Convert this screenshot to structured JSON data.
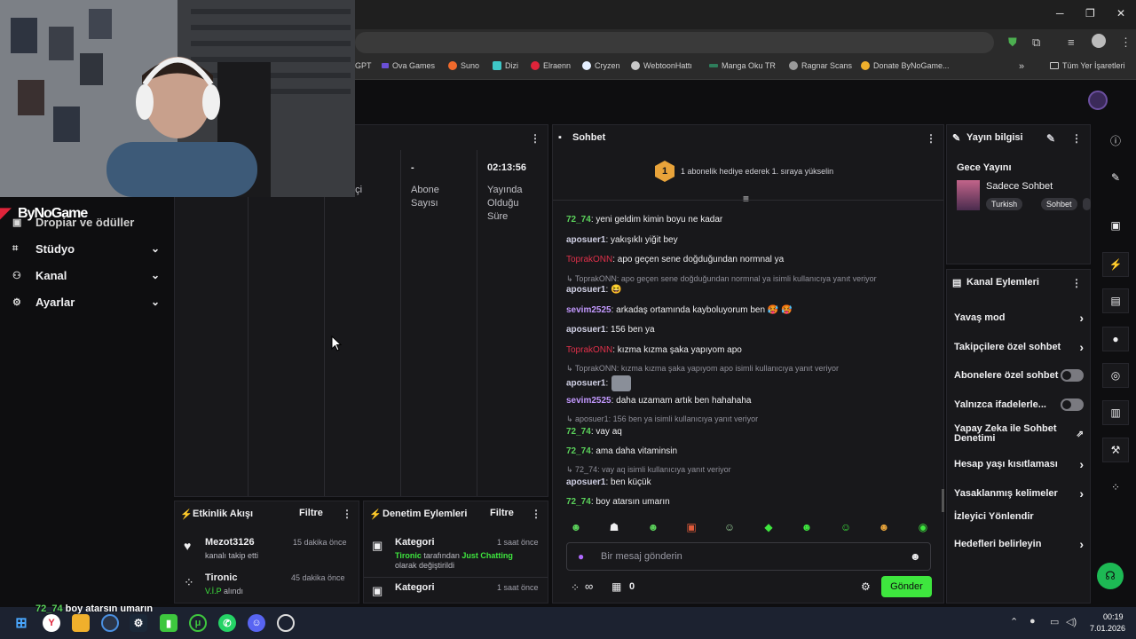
{
  "bookmarks": [
    "GPT",
    "Ova Games",
    "Suno",
    "Dizi",
    "Elraenn",
    "Cryzen",
    "WebtoonHattı",
    "Manga Oku TR",
    "Ragnar Scans",
    "Donate ByNoGame...",
    "Tüm Yer İşaretleri"
  ],
  "overlay": {
    "logo_text": "ByNoGame",
    "chat_user": "72_74",
    "chat_text": "boy atarsın umarın"
  },
  "sidebar": {
    "partial_item": "Dropiar ve ödüller",
    "items": [
      {
        "label": "Stüdyo",
        "icon": "studio-icon"
      },
      {
        "label": "Kanal",
        "icon": "channel-icon"
      },
      {
        "label": "Ayarlar",
        "icon": "settings-icon"
      }
    ]
  },
  "stats": {
    "partial_label": "oçi",
    "subs_value": "-",
    "subs_label": "Abone Sayısı",
    "uptime_value": "02:13:56",
    "uptime_label": "Yayında Olduğu Süre"
  },
  "chat": {
    "title": "Sohbet",
    "hype_rank": "1",
    "hype_text": "1 abonelik hediye ederek 1. sıraya yükselin",
    "messages": [
      {
        "user": "72_74",
        "text": ": yeni geldim kimin boyu ne kadar"
      },
      {
        "user": "aposuer1",
        "text": ": yakışıklı yiğit bey"
      },
      {
        "user": "ToprakONN",
        "text": ": apo geçen sene doğduğundan normnal ya"
      },
      {
        "reply": "ToprakONN: apo geçen sene doğduğundan normnal ya isimli kullanıcıya yanıt veriyor"
      },
      {
        "user": "aposuer1",
        "text": ": 😆"
      },
      {
        "user": "sevim2525",
        "text": ": arkadaş ortamında kayboluyorum ben 🥵 🥵"
      },
      {
        "user": "aposuer1",
        "text": ": 156 ben ya"
      },
      {
        "user": "ToprakONN",
        "text": ": kızma kızma şaka yapıyom apo"
      },
      {
        "reply": "ToprakONN: kızma kızma şaka yapıyom apo isimli kullanıcıya yanıt veriyor"
      },
      {
        "user": "aposuer1",
        "text": ":"
      },
      {
        "user": "sevim2525",
        "text": ": daha uzamam artık ben hahahaha"
      },
      {
        "reply": "aposuer1: 156 ben ya isimli kullanıcıya yanıt veriyor"
      },
      {
        "user": "72_74",
        "text": ": vay aq"
      },
      {
        "user": "72_74",
        "text": ": ama daha vitaminsin"
      },
      {
        "reply": "72_74: vay aq isimli kullanıcıya yanıt veriyor"
      },
      {
        "user": "aposuer1",
        "text": ": ben küçük"
      },
      {
        "user": "72_74",
        "text": ": boy atarsın umarın"
      }
    ],
    "input_placeholder": "Bir mesaj gönderin",
    "points": "∞",
    "drops_count": "0",
    "send_label": "Gönder"
  },
  "stream_info": {
    "title": "Yayın bilgisi",
    "stream_title": "Gece Yayını",
    "category": "Sadece Sohbet",
    "tags": [
      "Turkish",
      "Sohbet"
    ]
  },
  "channel_actions": {
    "title": "Kanal Eylemleri",
    "items": [
      {
        "label": "Yavaş mod",
        "type": "chevron"
      },
      {
        "label": "Takipçilere özel sohbet",
        "type": "chevron"
      },
      {
        "label": "Abonelere özel sohbet",
        "type": "toggle"
      },
      {
        "label": "Yalnızca ifadelerle...",
        "type": "toggle"
      },
      {
        "label": "Yapay Zeka ile Sohbet Denetimi",
        "type": "external"
      },
      {
        "label": "Hesap yaşı kısıtlaması",
        "type": "chevron"
      },
      {
        "label": "Yasaklanmış kelimeler",
        "type": "chevron"
      },
      {
        "label": "İzleyici Yönlendir",
        "type": "none"
      },
      {
        "label": "Hedefleri belirleyin",
        "type": "chevron"
      }
    ]
  },
  "activity": {
    "title": "Etkinlik Akışı",
    "filter": "Filtre",
    "events": [
      {
        "name": "Mezot3126",
        "sub": "kanalı takip etti",
        "time": "15 dakika önce"
      },
      {
        "name": "Tironic",
        "sub_accent": "V.İ.P",
        "sub": " alındı",
        "time": "45 dakika önce"
      }
    ]
  },
  "moderation": {
    "title": "Denetim Eylemleri",
    "filter": "Filtre",
    "events": [
      {
        "name": "Kategori",
        "actor": "Tironic",
        "mid": " tarafından ",
        "target": "Just Chatting",
        "tail": "olarak değiştirildi",
        "time": "1 saat önce"
      },
      {
        "name": "Kategori",
        "time": "1 saat önce"
      }
    ]
  },
  "taskbar": {
    "time": "00:19",
    "date": "7.01.2026"
  },
  "colors": {
    "accent": "#3ee63e",
    "bg": "#0e0e10",
    "panel": "#18181b"
  }
}
